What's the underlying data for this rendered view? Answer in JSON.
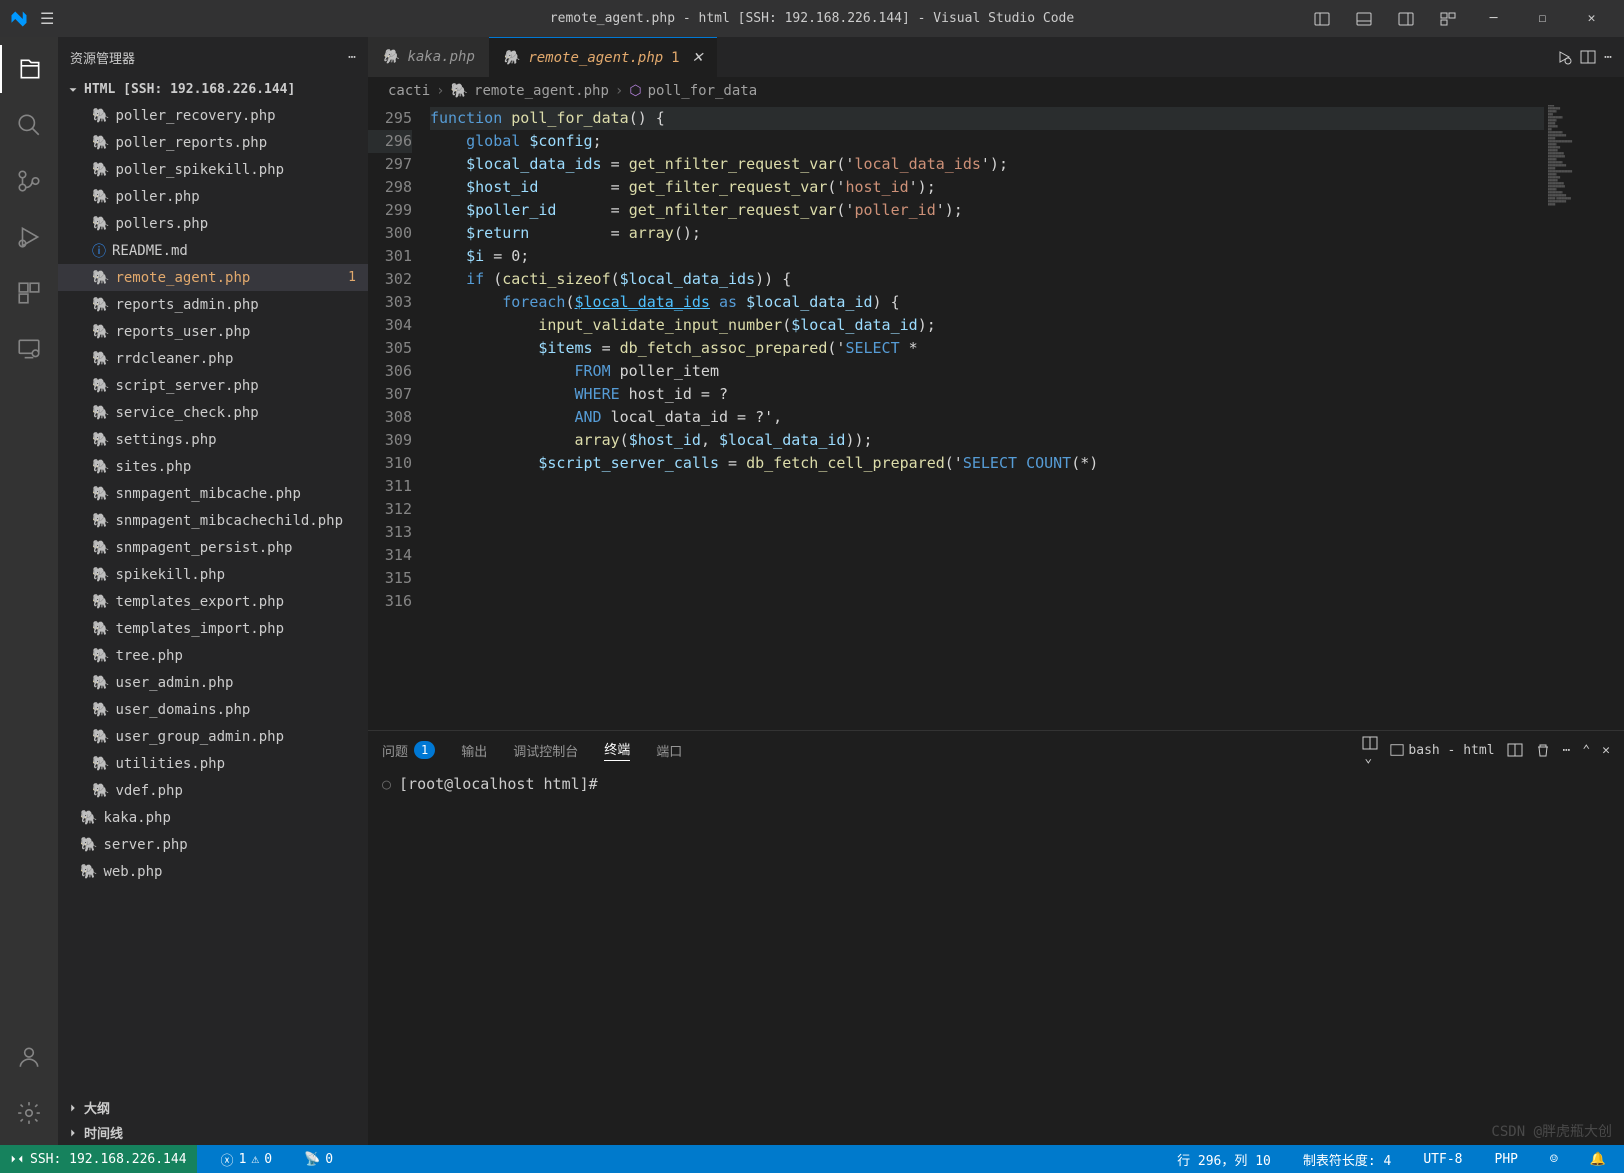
{
  "titlebar": {
    "title": "remote_agent.php - html [SSH: 192.168.226.144] - Visual Studio Code"
  },
  "sidebar": {
    "title": "资源管理器",
    "header": "HTML [SSH: 192.168.226.144]",
    "files": [
      {
        "name": "poller_recovery.php",
        "type": "php",
        "nested": true
      },
      {
        "name": "poller_reports.php",
        "type": "php",
        "nested": true
      },
      {
        "name": "poller_spikekill.php",
        "type": "php",
        "nested": true
      },
      {
        "name": "poller.php",
        "type": "php",
        "nested": true
      },
      {
        "name": "pollers.php",
        "type": "php",
        "nested": true
      },
      {
        "name": "README.md",
        "type": "info",
        "nested": true
      },
      {
        "name": "remote_agent.php",
        "type": "php",
        "nested": true,
        "active": true,
        "badge": "1"
      },
      {
        "name": "reports_admin.php",
        "type": "php",
        "nested": true
      },
      {
        "name": "reports_user.php",
        "type": "php",
        "nested": true
      },
      {
        "name": "rrdcleaner.php",
        "type": "php",
        "nested": true
      },
      {
        "name": "script_server.php",
        "type": "php",
        "nested": true
      },
      {
        "name": "service_check.php",
        "type": "php",
        "nested": true
      },
      {
        "name": "settings.php",
        "type": "php",
        "nested": true
      },
      {
        "name": "sites.php",
        "type": "php",
        "nested": true
      },
      {
        "name": "snmpagent_mibcache.php",
        "type": "php",
        "nested": true
      },
      {
        "name": "snmpagent_mibcachechild.php",
        "type": "php",
        "nested": true
      },
      {
        "name": "snmpagent_persist.php",
        "type": "php",
        "nested": true
      },
      {
        "name": "spikekill.php",
        "type": "php",
        "nested": true
      },
      {
        "name": "templates_export.php",
        "type": "php",
        "nested": true
      },
      {
        "name": "templates_import.php",
        "type": "php",
        "nested": true
      },
      {
        "name": "tree.php",
        "type": "php",
        "nested": true
      },
      {
        "name": "user_admin.php",
        "type": "php",
        "nested": true
      },
      {
        "name": "user_domains.php",
        "type": "php",
        "nested": true
      },
      {
        "name": "user_group_admin.php",
        "type": "php",
        "nested": true
      },
      {
        "name": "utilities.php",
        "type": "php",
        "nested": true
      },
      {
        "name": "vdef.php",
        "type": "php",
        "nested": true
      },
      {
        "name": "kaka.php",
        "type": "php"
      },
      {
        "name": "server.php",
        "type": "php"
      },
      {
        "name": "web.php",
        "type": "php"
      }
    ],
    "sections": [
      "大纲",
      "时间线"
    ]
  },
  "tabs": [
    {
      "label": "kaka.php",
      "active": false
    },
    {
      "label": "remote_agent.php",
      "active": true,
      "mod": "1"
    }
  ],
  "breadcrumb": {
    "root": "cacti",
    "file": "remote_agent.php",
    "symbol": "poll_for_data"
  },
  "code": {
    "start": 295,
    "lines": [
      "",
      "function poll_for_data() {",
      "    global $config;",
      "",
      "    $local_data_ids = get_nfilter_request_var('local_data_ids');",
      "    $host_id        = get_filter_request_var('host_id');",
      "    $poller_id      = get_nfilter_request_var('poller_id');",
      "    $return         = array();",
      "",
      "    $i = 0;",
      "",
      "    if (cacti_sizeof($local_data_ids)) {",
      "        foreach($local_data_ids as $local_data_id) {",
      "            input_validate_input_number($local_data_id);",
      "",
      "            $items = db_fetch_assoc_prepared('SELECT *",
      "                FROM poller_item",
      "                WHERE host_id = ?",
      "                AND local_data_id = ?',",
      "                array($host_id, $local_data_id));",
      "",
      "            $script_server_calls = db_fetch_cell_prepared('SELECT COUNT(*)"
    ]
  },
  "panel": {
    "tabs": [
      "问题",
      "输出",
      "调试控制台",
      "终端",
      "端口"
    ],
    "active": 3,
    "problems_count": "1",
    "shell": "bash - html"
  },
  "terminal": {
    "prompt": "[root@localhost html]#"
  },
  "statusbar": {
    "ssh": "SSH: 192.168.226.144",
    "errors": "1",
    "warnings": "0",
    "ports": "0",
    "ln": "行 296，列 10",
    "tabsize": "制表符长度: 4",
    "encoding": "UTF-8",
    "lang": "PHP",
    "notif": ""
  },
  "watermark": "CSDN @胖虎瓶大创"
}
